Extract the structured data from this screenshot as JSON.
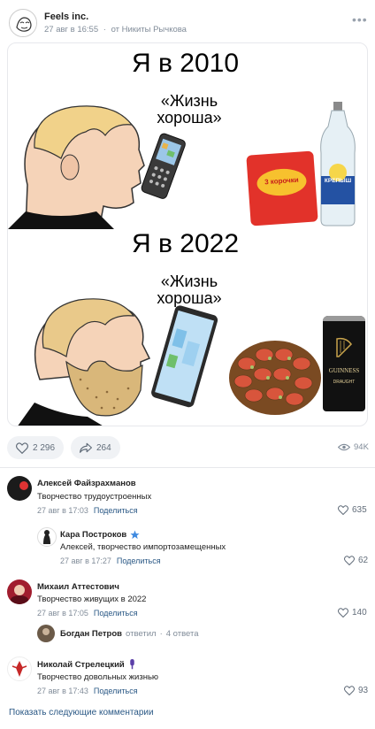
{
  "post": {
    "author": "Feels inc.",
    "date": "27 авг в 16:55",
    "via": "от Никиты Рычкова"
  },
  "meme": {
    "top_title": "Я в 2010",
    "top_quote": "«Жизнь хороша»",
    "top_snack_label": "3 корочки",
    "top_drink_label": "КРЕПЫШ",
    "bottom_title": "Я в 2022",
    "bottom_quote": "«Жизнь хороша»",
    "beer_label": "GUINNESS",
    "beer_sub": "DRAUGHT"
  },
  "actions": {
    "likes": "2 296",
    "shares": "264",
    "views": "94K"
  },
  "comments": [
    {
      "name": "Алексей Файзрахманов",
      "text": "Творчество трудоустроенных",
      "date": "27 авг в 17:03",
      "share": "Поделиться",
      "likes": "635"
    },
    {
      "name": "Кара Построков",
      "text": "Алексей, творчество импортозамещенных",
      "date": "27 авг в 17:27",
      "share": "Поделиться",
      "likes": "62"
    },
    {
      "name": "Михаил Аттестович",
      "text": "Творчество живущих в 2022",
      "date": "27 авг в 17:05",
      "share": "Поделиться",
      "likes": "140"
    },
    {
      "name": "Николай Стрелецкий",
      "text": "Творчество довольных жизнью",
      "date": "27 авг в 17:43",
      "share": "Поделиться",
      "likes": "93"
    }
  ],
  "thread": {
    "name": "Богдан Петров",
    "action": "ответил",
    "count": "4 ответа"
  },
  "more_comments": "Показать следующие комментарии",
  "colors": {
    "link": "#2a5885",
    "muted": "#818c99",
    "verified": "#3f8ae0"
  }
}
